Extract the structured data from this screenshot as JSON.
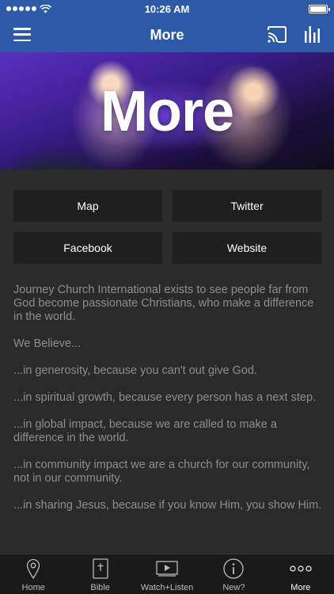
{
  "status_bar": {
    "time": "10:26 AM"
  },
  "nav": {
    "title": "More"
  },
  "hero": {
    "title": "More"
  },
  "buttons": [
    "Map",
    "Twitter",
    "Facebook",
    "Website"
  ],
  "paragraphs": [
    "Journey Church International exists to see people far from God become passionate Christians, who make a difference in the world.",
    "We Believe...",
    "...in generosity, because you can't out give God.",
    "...in spiritual growth, because every person has a next step.",
    "...in global impact, because we are called to make a difference in the world.",
    "...in community impact we are a church for our community, not in our community.",
    "...in sharing Jesus, because if you know Him, you show Him."
  ],
  "tabs": [
    {
      "label": "Home",
      "icon": "map-pin-icon"
    },
    {
      "label": "Bible",
      "icon": "bible-icon"
    },
    {
      "label": "Watch+Listen",
      "icon": "play-icon"
    },
    {
      "label": "New?",
      "icon": "info-icon"
    },
    {
      "label": "More",
      "icon": "more-icon"
    }
  ],
  "colors": {
    "header": "#2d5aa6",
    "background": "#2a2a2a",
    "button": "#1f1f1f",
    "tab_bar": "#1a1a1a"
  }
}
